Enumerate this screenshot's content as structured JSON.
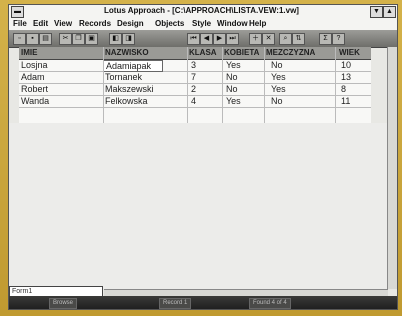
{
  "window": {
    "title": "Lotus Approach - [C:\\APPROACH\\LISTA.VEW:1.vw]",
    "min_symbol": "▼",
    "max_symbol": "▲"
  },
  "menubar": [
    "File",
    "Edit",
    "View",
    "Records",
    "Design",
    "Objects",
    "Style",
    "Window",
    "Help"
  ],
  "toolbar": {
    "nav_first": "⏮",
    "nav_prev": "◀",
    "nav_next": "▶",
    "nav_last": "⏭"
  },
  "table": {
    "columns": [
      "IMIE",
      "NAZWISKO",
      "KLASA",
      "KOBIETA",
      "MEZCZYZNA",
      "WIEK"
    ],
    "rows": [
      [
        "Losjna",
        "Adamiapak",
        "3",
        "Yes",
        "No",
        "10"
      ],
      [
        "Adam",
        "Tornanek",
        "7",
        "No",
        "Yes",
        "13"
      ],
      [
        "Robert",
        "Makszewski",
        "2",
        "No",
        "Yes",
        "8"
      ],
      [
        "Wanda",
        "Felkowska",
        "4",
        "Yes",
        "No",
        "11"
      ]
    ]
  },
  "findbox": {
    "value": "Form1"
  },
  "statusbar": {
    "seg1": "Browse",
    "seg2": "Record 1",
    "seg3": "Found 4 of 4"
  }
}
